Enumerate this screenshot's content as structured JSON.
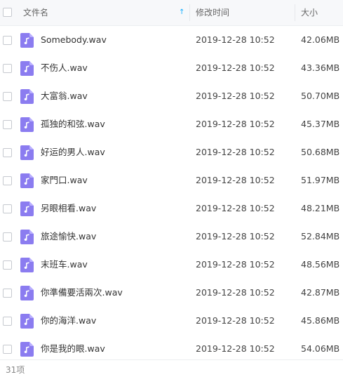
{
  "header": {
    "name": "文件名",
    "modified": "修改时间",
    "size": "大小",
    "sort_indicator": "↑"
  },
  "files": [
    {
      "name": "Somebody.wav",
      "modified": "2019-12-28 10:52",
      "size": "42.06MB"
    },
    {
      "name": "不伤人.wav",
      "modified": "2019-12-28 10:52",
      "size": "43.36MB"
    },
    {
      "name": "大富翁.wav",
      "modified": "2019-12-28 10:52",
      "size": "50.70MB"
    },
    {
      "name": "孤独的和弦.wav",
      "modified": "2019-12-28 10:52",
      "size": "45.37MB"
    },
    {
      "name": "好运的男人.wav",
      "modified": "2019-12-28 10:52",
      "size": "50.68MB"
    },
    {
      "name": "家門口.wav",
      "modified": "2019-12-28 10:52",
      "size": "51.97MB"
    },
    {
      "name": "另眼相看.wav",
      "modified": "2019-12-28 10:52",
      "size": "48.21MB"
    },
    {
      "name": "旅途愉快.wav",
      "modified": "2019-12-28 10:52",
      "size": "52.84MB"
    },
    {
      "name": "末班车.wav",
      "modified": "2019-12-28 10:52",
      "size": "48.56MB"
    },
    {
      "name": "你準備要活兩次.wav",
      "modified": "2019-12-28 10:52",
      "size": "42.87MB"
    },
    {
      "name": "你的海洋.wav",
      "modified": "2019-12-28 10:52",
      "size": "45.86MB"
    },
    {
      "name": "你是我的眼.wav",
      "modified": "2019-12-28 10:52",
      "size": "54.06MB"
    }
  ],
  "footer": {
    "count": "31项"
  },
  "colors": {
    "icon": "#8b7cf0",
    "accent": "#09aaff"
  },
  "icons": {
    "file": "music-file-icon",
    "sort": "sort-ascending-icon"
  }
}
